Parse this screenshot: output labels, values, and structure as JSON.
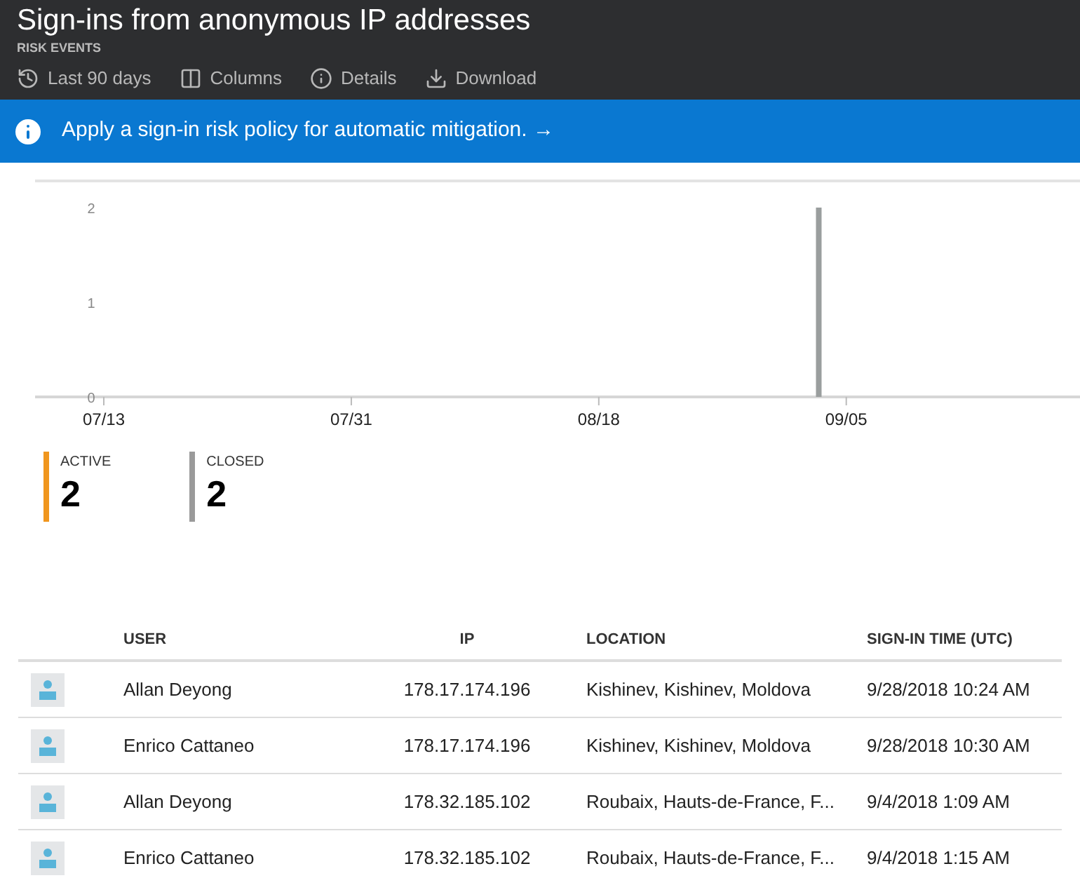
{
  "header": {
    "title": "Sign-ins from anonymous IP addresses",
    "subtitle": "RISK EVENTS"
  },
  "toolbar": [
    {
      "kind": "clock",
      "label": "Last 90 days"
    },
    {
      "kind": "columns",
      "label": "Columns"
    },
    {
      "kind": "info",
      "label": "Details"
    },
    {
      "kind": "download",
      "label": "Download"
    }
  ],
  "banner": {
    "text": "Apply a sign-in risk policy for automatic mitigation.",
    "arrow": "→"
  },
  "chart": {
    "chart_data": {
      "type": "bar",
      "categories": [
        null,
        null,
        "07/13",
        null,
        null,
        null,
        null,
        null,
        null,
        null,
        null,
        "07/31",
        null,
        null,
        null,
        null,
        null,
        null,
        null,
        null,
        "08/18",
        null,
        null,
        null,
        null,
        null,
        null,
        null,
        null,
        "09/05",
        null,
        null,
        null,
        null,
        null,
        null,
        null,
        null
      ],
      "values": [
        null,
        null,
        null,
        null,
        null,
        null,
        null,
        null,
        null,
        null,
        null,
        null,
        null,
        null,
        null,
        null,
        null,
        null,
        null,
        null,
        null,
        null,
        null,
        null,
        null,
        null,
        null,
        null,
        2,
        null,
        null,
        null,
        null,
        null,
        null,
        null,
        null,
        null
      ],
      "ylim": [
        0,
        2
      ],
      "yticks": [
        0,
        1,
        2
      ]
    }
  },
  "stats": [
    {
      "label": "ACTIVE",
      "value": "2",
      "color": "#f0961e"
    },
    {
      "label": "CLOSED",
      "value": "2",
      "color": "#9a9a9a"
    }
  ],
  "table": {
    "columns": [
      "USER",
      "IP",
      "LOCATION",
      "SIGN-IN TIME (UTC)"
    ],
    "rows": [
      [
        "Allan Deyong",
        "178.17.174.196",
        "Kishinev, Kishinev, Moldova",
        "9/28/2018 10:24 AM"
      ],
      [
        "Enrico Cattaneo",
        "178.17.174.196",
        "Kishinev, Kishinev, Moldova",
        "9/28/2018 10:30 AM"
      ],
      [
        "Allan Deyong",
        "178.32.185.102",
        "Roubaix, Hauts-de-France, F...",
        "9/4/2018 1:09 AM"
      ],
      [
        "Enrico Cattaneo",
        "178.32.185.102",
        "Roubaix, Hauts-de-France, F...",
        "9/4/2018 1:15 AM"
      ]
    ]
  }
}
